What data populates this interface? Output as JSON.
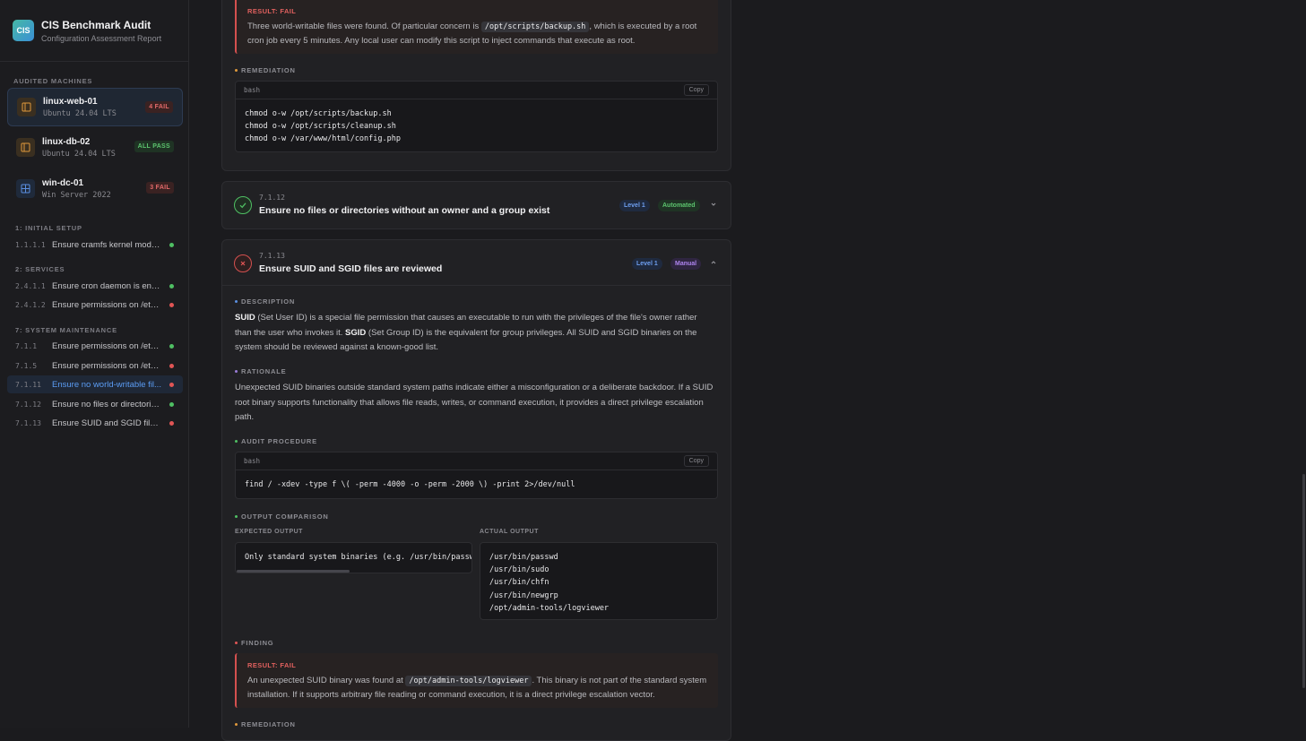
{
  "brand": {
    "logo": "CIS",
    "title": "CIS Benchmark Audit",
    "subtitle": "Configuration Assessment Report"
  },
  "sidebar": {
    "machines_label": "AUDITED MACHINES",
    "machines": [
      {
        "name": "linux-web-01",
        "os": "Ubuntu 24.04 LTS",
        "badge": "4 FAIL",
        "status": "fail",
        "icon": "linux-server-icon"
      },
      {
        "name": "linux-db-02",
        "os": "Ubuntu 24.04 LTS",
        "badge": "ALL PASS",
        "status": "pass",
        "icon": "linux-server-icon"
      },
      {
        "name": "win-dc-01",
        "os": "Win Server 2022",
        "badge": "3 FAIL",
        "status": "fail",
        "icon": "windows-icon"
      }
    ],
    "groups": [
      {
        "label": "1: INITIAL SETUP",
        "items": [
          {
            "num": "1.1.1.1",
            "title": "Ensure cramfs kernel modul...",
            "status": "pass"
          }
        ]
      },
      {
        "label": "2: SERVICES",
        "items": [
          {
            "num": "2.4.1.1",
            "title": "Ensure cron daemon is enab...",
            "status": "pass"
          },
          {
            "num": "2.4.1.2",
            "title": "Ensure permissions on /etc/...",
            "status": "fail"
          }
        ]
      },
      {
        "label": "7: SYSTEM MAINTENANCE",
        "items": [
          {
            "num": "7.1.1",
            "title": "Ensure permissions on /etc/...",
            "status": "pass"
          },
          {
            "num": "7.1.5",
            "title": "Ensure permissions on /etc/...",
            "status": "fail"
          },
          {
            "num": "7.1.11",
            "title": "Ensure no world-writable fil...",
            "status": "fail"
          },
          {
            "num": "7.1.12",
            "title": "Ensure no files or directories...",
            "status": "pass"
          },
          {
            "num": "7.1.13",
            "title": "Ensure SUID and SGID files ...",
            "status": "fail"
          }
        ]
      }
    ]
  },
  "prev_check": {
    "result_tag": "RESULT: FAIL",
    "result_pre": "Three world-writable files were found. Of particular concern is ",
    "result_code": "/opt/scripts/backup.sh",
    "result_post": ", which is executed by a root cron job every 5 minutes. Any local user can modify this script to inject commands that execute as root.",
    "remediation_label": "REMEDIATION",
    "remediation_lang": "bash",
    "copy_label": "Copy",
    "remediation_code": "chmod o-w /opt/scripts/backup.sh\nchmod o-w /opt/scripts/cleanup.sh\nchmod o-w /var/www/html/config.php"
  },
  "check_12": {
    "num": "7.1.12",
    "title": "Ensure no files or directories without an owner and a group exist",
    "level": "Level 1",
    "mode": "Automated"
  },
  "check_13": {
    "num": "7.1.13",
    "title": "Ensure SUID and SGID files are reviewed",
    "level": "Level 1",
    "mode": "Manual",
    "description_label": "DESCRIPTION",
    "desc_suid": "SUID",
    "desc_p1": " (Set User ID) is a special file permission that causes an executable to run with the privileges of the file's owner rather than the user who invokes it. ",
    "desc_sgid": "SGID",
    "desc_p2": " (Set Group ID) is the equivalent for group privileges. All SUID and SGID binaries on the system should be reviewed against a known-good list.",
    "rationale_label": "RATIONALE",
    "rationale": "Unexpected SUID binaries outside standard system paths indicate either a misconfiguration or a deliberate backdoor. If a SUID root binary supports functionality that allows file reads, writes, or command execution, it provides a direct privilege escalation path.",
    "audit_label": "AUDIT PROCEDURE",
    "audit_lang": "bash",
    "copy_label": "Copy",
    "audit_code": "find / -xdev -type f \\( -perm -4000 -o -perm -2000 \\) -print 2>/dev/null",
    "output_label": "OUTPUT COMPARISON",
    "expected_label": "EXPECTED OUTPUT",
    "expected_output": "Only standard system binaries (e.g. /usr/bin/passwd, /usr/bin/sudo)",
    "actual_label": "ACTUAL OUTPUT",
    "actual_output": "/usr/bin/passwd\n/usr/bin/sudo\n/usr/bin/chfn\n/usr/bin/newgrp\n/opt/admin-tools/logviewer",
    "finding_label": "FINDING",
    "result_tag": "RESULT: FAIL",
    "finding_pre": "An unexpected SUID binary was found at ",
    "finding_code": "/opt/admin-tools/logviewer",
    "finding_post": ". This binary is not part of the standard system installation. If it supports arbitrary file reading or command execution, it is a direct privilege escalation vector.",
    "remediation_label": "REMEDIATION"
  },
  "colors": {
    "pass": "#4fbf63",
    "fail": "#e05555",
    "accent": "#5b9cf3"
  }
}
